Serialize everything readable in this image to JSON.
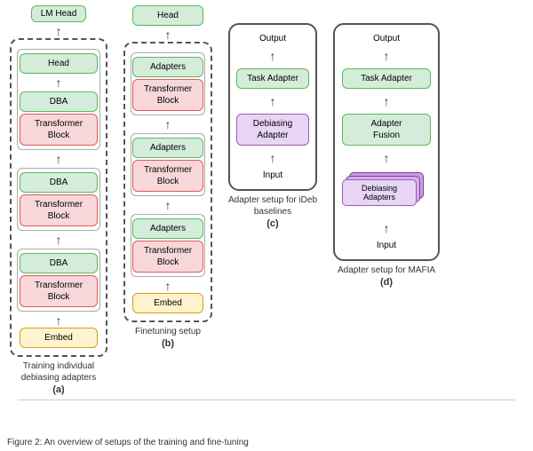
{
  "diagrams": {
    "panel_a": {
      "label": "(a)",
      "caption": "Training individual debiasing adapters",
      "lm_head": "LM Head",
      "head_inner": "Head",
      "dba": "DBA",
      "transformer_block": "Transformer\nBlock",
      "embed": "Embed"
    },
    "panel_b": {
      "label": "(b)",
      "caption": "Finetuning setup",
      "head": "Head",
      "adapters": "Adapters",
      "transformer_block": "Transformer\nBlock",
      "embed": "Embed"
    },
    "panel_c": {
      "label": "(c)",
      "caption": "Adapter setup for\niDeb baselines",
      "output": "Output",
      "task_adapter": "Task Adapter",
      "debiasing_adapter": "Debiasing\nAdapter",
      "input": "Input"
    },
    "panel_d": {
      "label": "(d)",
      "caption": "Adapter setup for\nMAFIA",
      "output": "Output",
      "task_adapter": "Task Adapter",
      "adapter_fusion": "Adapter\nFusion",
      "debiasing_adapters": "Debiasing\nAdapters",
      "input": "Input"
    }
  },
  "figure_caption": "Figure 2: An overview of setups of the training and fine-tuning"
}
